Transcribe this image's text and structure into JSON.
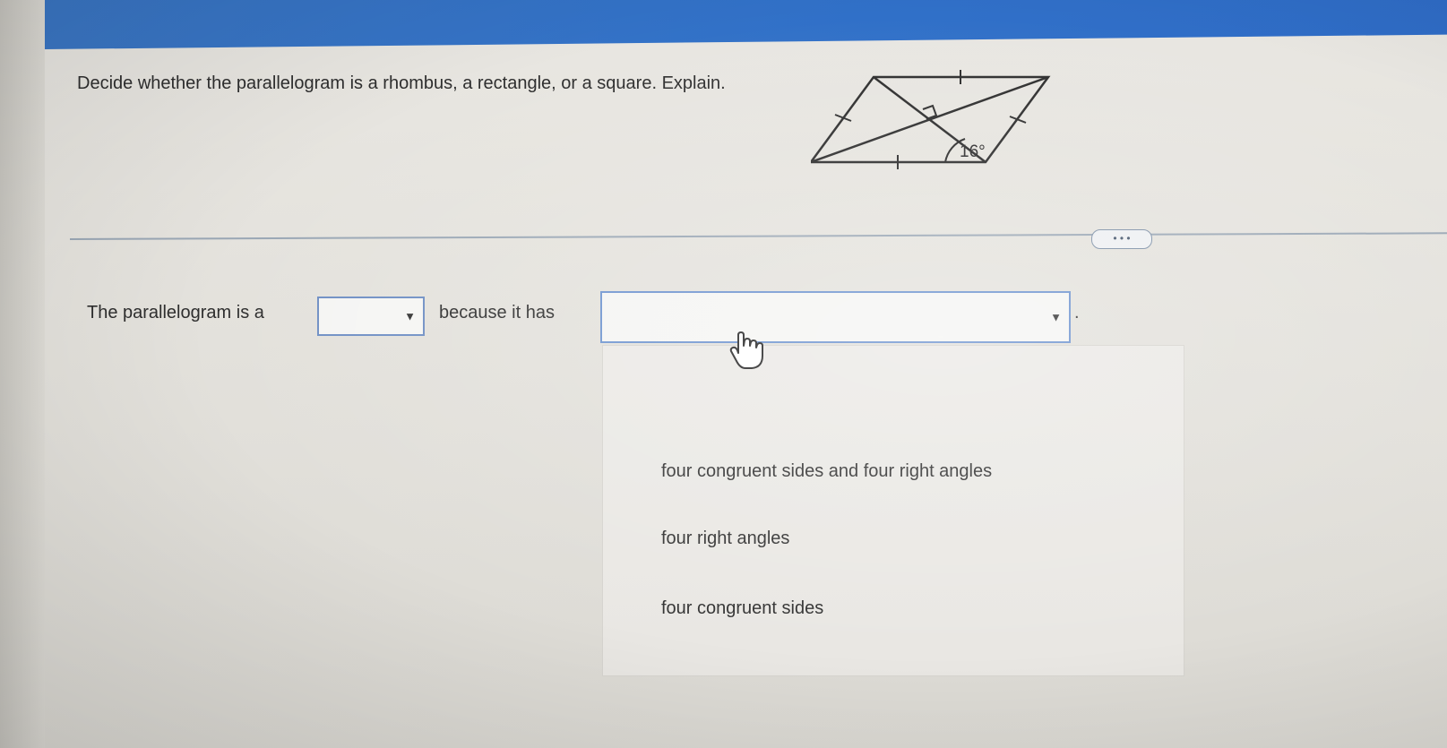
{
  "question": {
    "text": "Decide whether the parallelogram is a rhombus, a rectangle, or a square. Explain."
  },
  "figure": {
    "angle_label": "16°"
  },
  "more_button": {
    "label": "• • •"
  },
  "answer": {
    "prefix": "The parallelogram is a",
    "middle": "because it has",
    "suffix": ".",
    "shape_select_value": "",
    "reason_select_value": ""
  },
  "dropdown": {
    "options": [
      "four congruent sides and four right angles",
      "four right angles",
      "four congruent sides"
    ]
  },
  "icons": {
    "caret": "dropdown-caret-icon",
    "cursor": "hand-pointer-icon"
  }
}
